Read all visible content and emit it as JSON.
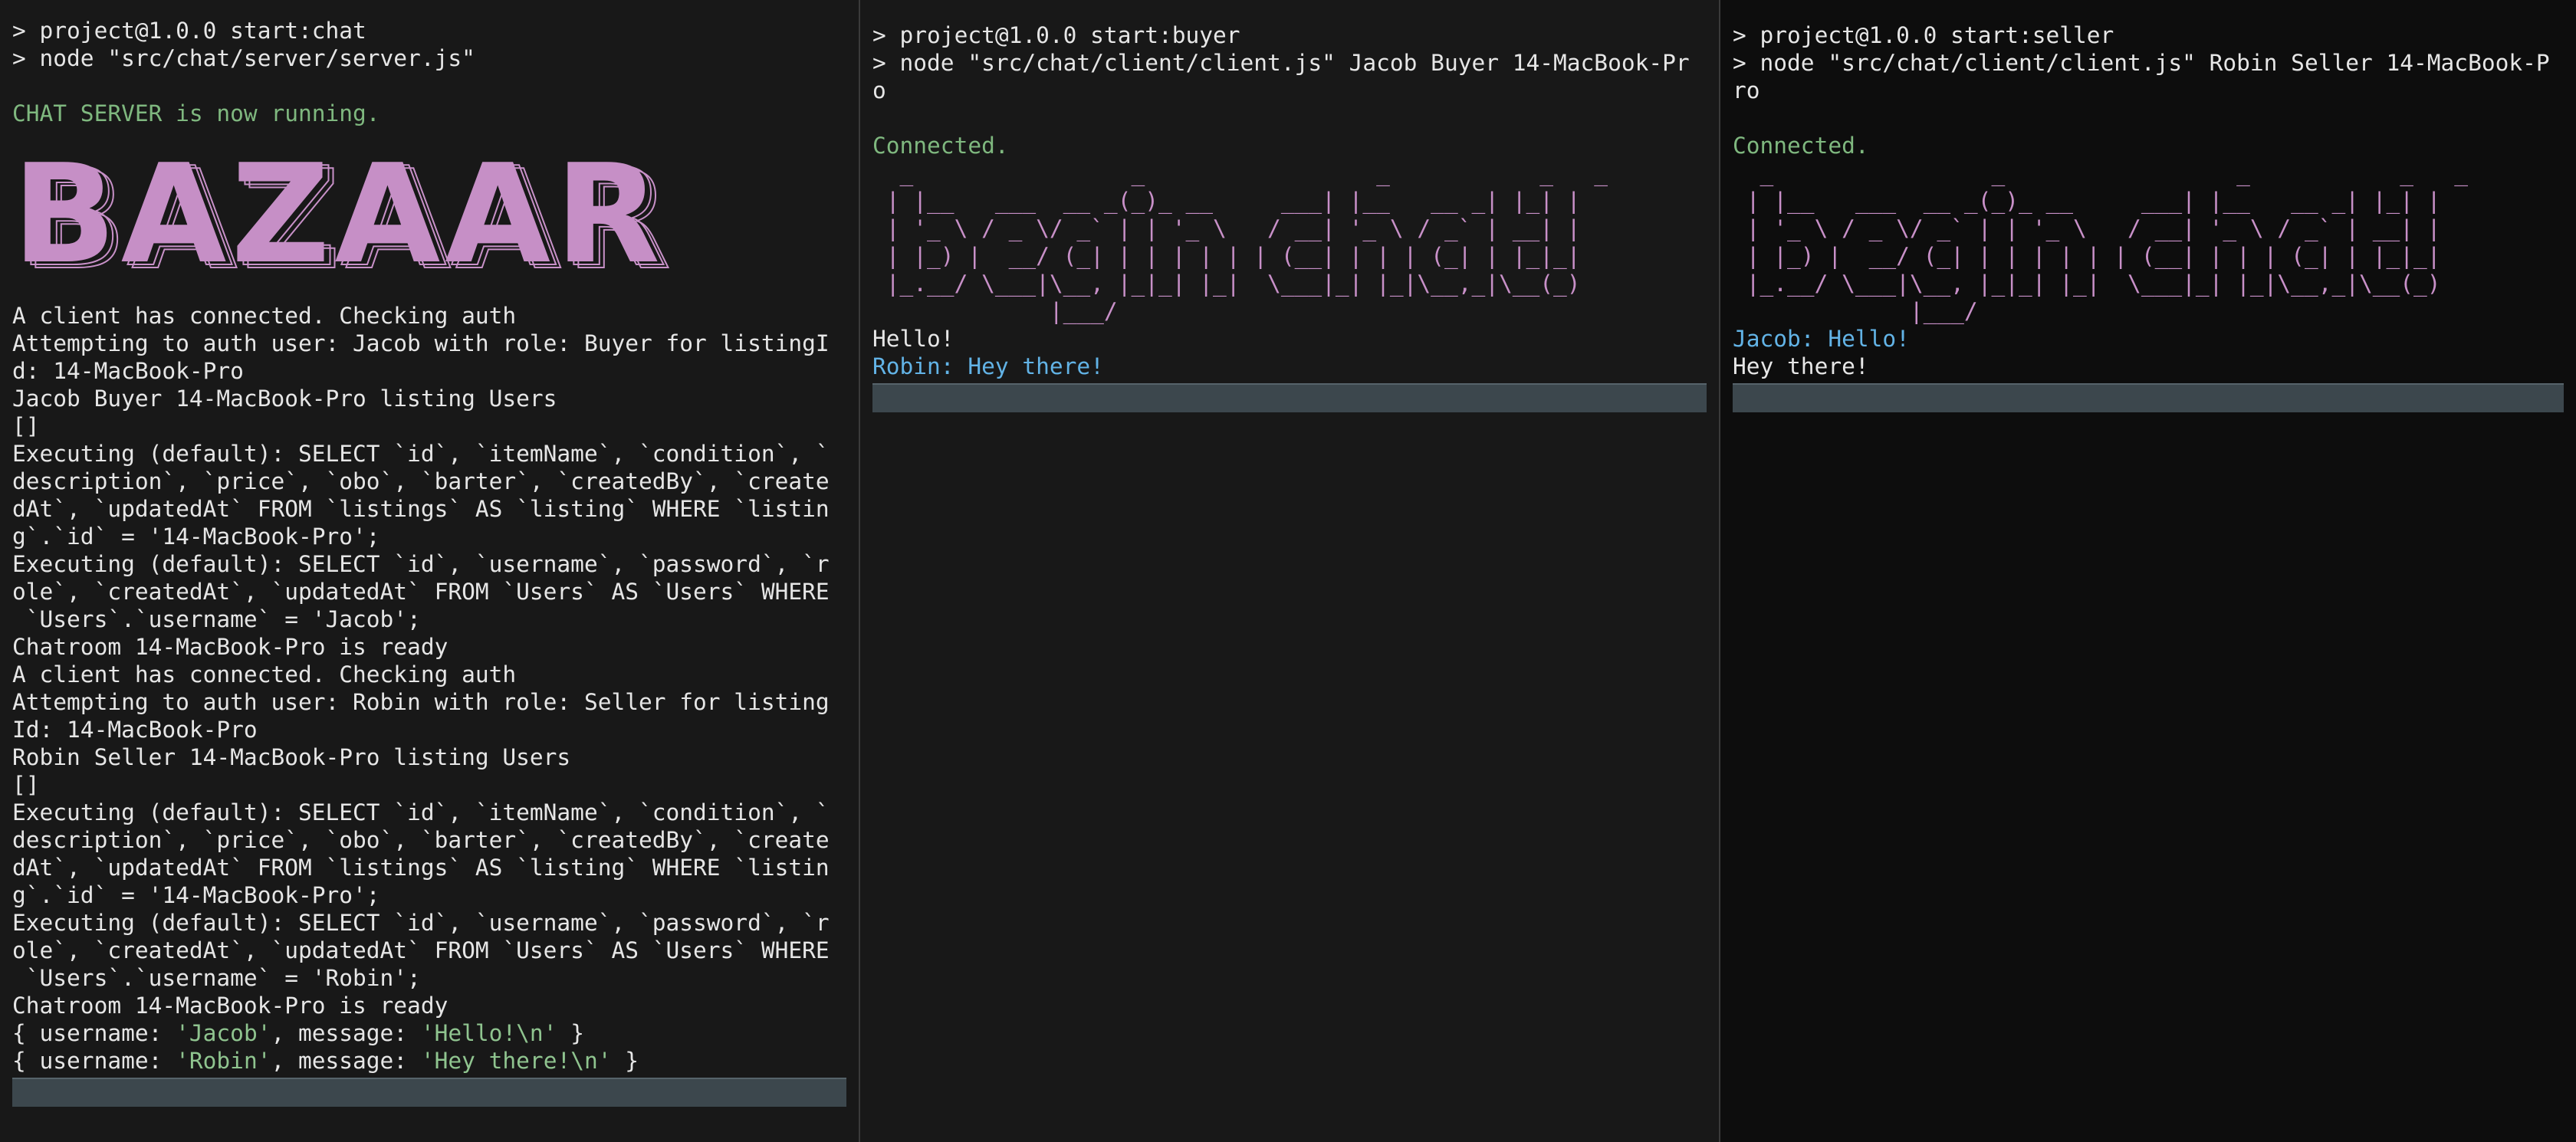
{
  "server": {
    "cmd1": "> project@1.0.0 start:chat",
    "cmd2": "> node \"src/chat/server/server.js\"",
    "running": "CHAT SERVER is now running.",
    "banner": "BAZAAR",
    "log": [
      "A client has connected. Checking auth",
      "Attempting to auth user: Jacob with role: Buyer for listingI",
      "d: 14-MacBook-Pro",
      "Jacob Buyer 14-MacBook-Pro listing Users",
      "[]",
      "Executing (default): SELECT `id`, `itemName`, `condition`, `",
      "description`, `price`, `obo`, `barter`, `createdBy`, `create",
      "dAt`, `updatedAt` FROM `listings` AS `listing` WHERE `listin",
      "g`.`id` = '14-MacBook-Pro';",
      "Executing (default): SELECT `id`, `username`, `password`, `r",
      "ole`, `createdAt`, `updatedAt` FROM `Users` AS `Users` WHERE",
      " `Users`.`username` = 'Jacob';",
      "Chatroom 14-MacBook-Pro is ready",
      "A client has connected. Checking auth",
      "Attempting to auth user: Robin with role: Seller for listing",
      "Id: 14-MacBook-Pro",
      "Robin Seller 14-MacBook-Pro listing Users",
      "[]",
      "Executing (default): SELECT `id`, `itemName`, `condition`, `",
      "description`, `price`, `obo`, `barter`, `createdBy`, `create",
      "dAt`, `updatedAt` FROM `listings` AS `listing` WHERE `listin",
      "g`.`id` = '14-MacBook-Pro';",
      "Executing (default): SELECT `id`, `username`, `password`, `r",
      "ole`, `createdAt`, `updatedAt` FROM `Users` AS `Users` WHERE",
      " `Users`.`username` = 'Robin';",
      "Chatroom 14-MacBook-Pro is ready"
    ],
    "msg1": {
      "open": "{ username: ",
      "user": "'Jacob'",
      "mid": ", message: ",
      "text": "'Hello!\\n'",
      "close": " }"
    },
    "msg2": {
      "open": "{ username: ",
      "user": "'Robin'",
      "mid": ", message: ",
      "text": "'Hey there!\\n'",
      "close": " }"
    }
  },
  "buyer": {
    "cmd1": "> project@1.0.0 start:buyer",
    "cmd2": "> node \"src/chat/client/client.js\" Jacob Buyer 14-MacBook-Pr",
    "cmd3": "o",
    "connected": "Connected.",
    "ascii": [
      "  _                _                 _           _   _ ",
      " | |__   ___  __ _(_)_ __     ___| |__   __ _| |_| |",
      " | '_ \\ / _ \\/ _` | | '_ \\   / __| '_ \\ / _` | __| |",
      " | |_) |  __/ (_| | | | | | | (__| | | | (_| | |_|_|",
      " |_.__/ \\___|\\__, |_|_| |_|  \\___|_| |_|\\__,_|\\__(_)",
      "             |___/                                   "
    ],
    "chat": [
      {
        "text": "Hello!",
        "color": "plain"
      },
      {
        "text": "Robin: Hey there!",
        "color": "blue"
      }
    ]
  },
  "seller": {
    "cmd1": "> project@1.0.0 start:seller",
    "cmd2": "> node \"src/chat/client/client.js\" Robin Seller 14-MacBook-P",
    "cmd3": "ro",
    "connected": "Connected.",
    "ascii": [
      "  _                _                 _           _   _ ",
      " | |__   ___  __ _(_)_ __     ___| |__   __ _| |_| |",
      " | '_ \\ / _ \\/ _` | | '_ \\   / __| '_ \\ / _` | __| |",
      " | |_) |  __/ (_| | | | | | | (__| | | | (_| | |_|_|",
      " |_.__/ \\___|\\__, |_|_| |_|  \\___|_| |_|\\__,_|\\__(_)",
      "             |___/                                   "
    ],
    "chat": [
      {
        "text": "Jacob: Hello!",
        "color": "blue"
      },
      {
        "text": "Hey there!",
        "color": "plain"
      }
    ]
  },
  "colors": {
    "green": "#7fb87f",
    "blue": "#62b3e6",
    "magenta": "#c68fc6",
    "input_bar": "#3c474d"
  }
}
